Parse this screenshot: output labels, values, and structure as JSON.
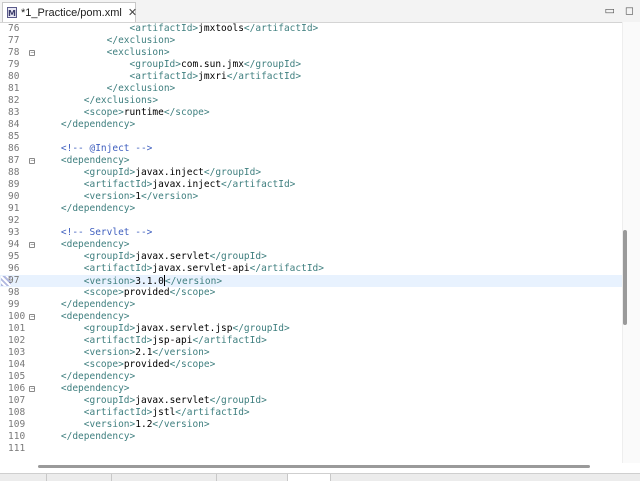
{
  "tab": {
    "title": "*1_Practice/pom.xml",
    "icon": "M",
    "close": "✕"
  },
  "window_controls": {
    "minimize": "▭",
    "maximize": "◻"
  },
  "editor": {
    "current_line": 97,
    "lines": [
      {
        "n": "76",
        "fold": false,
        "segs": [
          [
            "txt",
            "                "
          ],
          [
            "tag",
            "<artifactId>"
          ],
          [
            "txt",
            "jmxtools"
          ],
          [
            "tag",
            "</artifactId>"
          ]
        ]
      },
      {
        "n": "77",
        "fold": false,
        "segs": [
          [
            "txt",
            "            "
          ],
          [
            "tag",
            "</exclusion>"
          ]
        ]
      },
      {
        "n": "78",
        "fold": true,
        "segs": [
          [
            "txt",
            "            "
          ],
          [
            "tag",
            "<exclusion>"
          ]
        ]
      },
      {
        "n": "79",
        "fold": false,
        "segs": [
          [
            "txt",
            "                "
          ],
          [
            "tag",
            "<groupId>"
          ],
          [
            "txt",
            "com.sun.jmx"
          ],
          [
            "tag",
            "</groupId>"
          ]
        ]
      },
      {
        "n": "80",
        "fold": false,
        "segs": [
          [
            "txt",
            "                "
          ],
          [
            "tag",
            "<artifactId>"
          ],
          [
            "txt",
            "jmxri"
          ],
          [
            "tag",
            "</artifactId>"
          ]
        ]
      },
      {
        "n": "81",
        "fold": false,
        "segs": [
          [
            "txt",
            "            "
          ],
          [
            "tag",
            "</exclusion>"
          ]
        ]
      },
      {
        "n": "82",
        "fold": false,
        "segs": [
          [
            "txt",
            "        "
          ],
          [
            "tag",
            "</exclusions>"
          ]
        ]
      },
      {
        "n": "83",
        "fold": false,
        "segs": [
          [
            "txt",
            "        "
          ],
          [
            "tag",
            "<scope>"
          ],
          [
            "txt",
            "runtime"
          ],
          [
            "tag",
            "</scope>"
          ]
        ]
      },
      {
        "n": "84",
        "fold": false,
        "segs": [
          [
            "txt",
            "    "
          ],
          [
            "tag",
            "</dependency>"
          ]
        ]
      },
      {
        "n": "85",
        "fold": false,
        "segs": []
      },
      {
        "n": "86",
        "fold": false,
        "segs": [
          [
            "txt",
            "    "
          ],
          [
            "cmt",
            "<!-- @Inject -->"
          ]
        ]
      },
      {
        "n": "87",
        "fold": true,
        "segs": [
          [
            "txt",
            "    "
          ],
          [
            "tag",
            "<dependency>"
          ]
        ]
      },
      {
        "n": "88",
        "fold": false,
        "segs": [
          [
            "txt",
            "        "
          ],
          [
            "tag",
            "<groupId>"
          ],
          [
            "txt",
            "javax.inject"
          ],
          [
            "tag",
            "</groupId>"
          ]
        ]
      },
      {
        "n": "89",
        "fold": false,
        "segs": [
          [
            "txt",
            "        "
          ],
          [
            "tag",
            "<artifactId>"
          ],
          [
            "txt",
            "javax.inject"
          ],
          [
            "tag",
            "</artifactId>"
          ]
        ]
      },
      {
        "n": "90",
        "fold": false,
        "segs": [
          [
            "txt",
            "        "
          ],
          [
            "tag",
            "<version>"
          ],
          [
            "txt",
            "1"
          ],
          [
            "tag",
            "</version>"
          ]
        ]
      },
      {
        "n": "91",
        "fold": false,
        "segs": [
          [
            "txt",
            "    "
          ],
          [
            "tag",
            "</dependency>"
          ]
        ]
      },
      {
        "n": "92",
        "fold": false,
        "segs": []
      },
      {
        "n": "93",
        "fold": false,
        "segs": [
          [
            "txt",
            "    "
          ],
          [
            "cmt",
            "<!-- Servlet -->"
          ]
        ]
      },
      {
        "n": "94",
        "fold": true,
        "segs": [
          [
            "txt",
            "    "
          ],
          [
            "tag",
            "<dependency>"
          ]
        ]
      },
      {
        "n": "95",
        "fold": false,
        "segs": [
          [
            "txt",
            "        "
          ],
          [
            "tag",
            "<groupId>"
          ],
          [
            "txt",
            "javax.servlet"
          ],
          [
            "tag",
            "</groupId>"
          ]
        ]
      },
      {
        "n": "96",
        "fold": false,
        "segs": [
          [
            "txt",
            "        "
          ],
          [
            "tag",
            "<artifactId>"
          ],
          [
            "txt",
            "javax.servlet-api"
          ],
          [
            "tag",
            "</artifactId>"
          ]
        ]
      },
      {
        "n": "97",
        "fold": false,
        "bookmark": true,
        "segs": [
          [
            "txt",
            "        "
          ],
          [
            "tag",
            "<version>"
          ],
          [
            "txt",
            "3.1.0"
          ],
          [
            "cursor",
            ""
          ],
          [
            "tag",
            "</version>"
          ]
        ]
      },
      {
        "n": "98",
        "fold": false,
        "segs": [
          [
            "txt",
            "        "
          ],
          [
            "tag",
            "<scope>"
          ],
          [
            "txt",
            "provided"
          ],
          [
            "tag",
            "</scope>"
          ]
        ]
      },
      {
        "n": "99",
        "fold": false,
        "segs": [
          [
            "txt",
            "    "
          ],
          [
            "tag",
            "</dependency>"
          ]
        ]
      },
      {
        "n": "100",
        "fold": true,
        "segs": [
          [
            "txt",
            "    "
          ],
          [
            "tag",
            "<dependency>"
          ]
        ]
      },
      {
        "n": "101",
        "fold": false,
        "segs": [
          [
            "txt",
            "        "
          ],
          [
            "tag",
            "<groupId>"
          ],
          [
            "txt",
            "javax.servlet.jsp"
          ],
          [
            "tag",
            "</groupId>"
          ]
        ]
      },
      {
        "n": "102",
        "fold": false,
        "segs": [
          [
            "txt",
            "        "
          ],
          [
            "tag",
            "<artifactId>"
          ],
          [
            "txt",
            "jsp-api"
          ],
          [
            "tag",
            "</artifactId>"
          ]
        ]
      },
      {
        "n": "103",
        "fold": false,
        "segs": [
          [
            "txt",
            "        "
          ],
          [
            "tag",
            "<version>"
          ],
          [
            "txt",
            "2.1"
          ],
          [
            "tag",
            "</version>"
          ]
        ]
      },
      {
        "n": "104",
        "fold": false,
        "segs": [
          [
            "txt",
            "        "
          ],
          [
            "tag",
            "<scope>"
          ],
          [
            "txt",
            "provided"
          ],
          [
            "tag",
            "</scope>"
          ]
        ]
      },
      {
        "n": "105",
        "fold": false,
        "segs": [
          [
            "txt",
            "    "
          ],
          [
            "tag",
            "</dependency>"
          ]
        ]
      },
      {
        "n": "106",
        "fold": true,
        "segs": [
          [
            "txt",
            "    "
          ],
          [
            "tag",
            "<dependency>"
          ]
        ]
      },
      {
        "n": "107",
        "fold": false,
        "segs": [
          [
            "txt",
            "        "
          ],
          [
            "tag",
            "<groupId>"
          ],
          [
            "txt",
            "javax.servlet"
          ],
          [
            "tag",
            "</groupId>"
          ]
        ]
      },
      {
        "n": "108",
        "fold": false,
        "segs": [
          [
            "txt",
            "        "
          ],
          [
            "tag",
            "<artifactId>"
          ],
          [
            "txt",
            "jstl"
          ],
          [
            "tag",
            "</artifactId>"
          ]
        ]
      },
      {
        "n": "109",
        "fold": false,
        "segs": [
          [
            "txt",
            "        "
          ],
          [
            "tag",
            "<version>"
          ],
          [
            "txt",
            "1.2"
          ],
          [
            "tag",
            "</version>"
          ]
        ]
      },
      {
        "n": "110",
        "fold": false,
        "segs": [
          [
            "txt",
            "    "
          ],
          [
            "tag",
            "</dependency>"
          ]
        ]
      },
      {
        "n": "111",
        "fold": false,
        "segs": []
      }
    ]
  },
  "colors": {
    "tag": "#3f7f7f",
    "text": "#000000",
    "comment": "#3f5fbf",
    "current_line": "#e8f2fe"
  }
}
